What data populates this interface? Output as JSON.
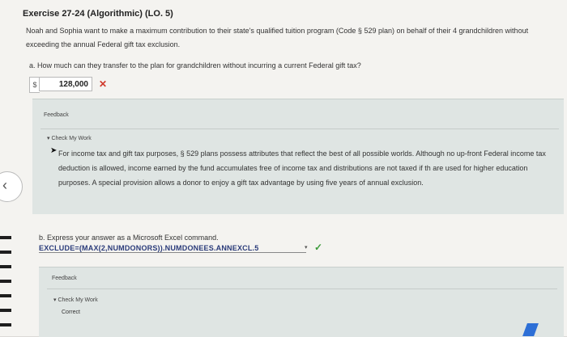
{
  "exercise": {
    "title": "Exercise 27-24 (Algorithmic) (LO. 5)",
    "problem": "Noah and Sophia want to make a maximum contribution to their state's qualified tuition program (Code § 529 plan) on behalf of their 4 grandchildren without exceeding the annual Federal gift tax exclusion."
  },
  "part_a": {
    "question": "a.  How much can they transfer to the plan for grandchildren without incurring a current Federal gift tax?",
    "currency": "$",
    "answer": "128,000",
    "status_mark": "✕",
    "feedback_label": "Feedback",
    "check_label": "▾ Check My Work",
    "explanation": "For income tax and gift tax purposes, § 529 plans possess attributes that reflect the best of all possible worlds. Although no up-front Federal income tax deduction is allowed, income earned by the fund accumulates free of income tax and distributions are not taxed if th are used for higher education purposes. A special provision allows a donor to enjoy a gift tax advantage by using five years of annual exclusion."
  },
  "part_b": {
    "question": "b.  Express your answer as a Microsoft Excel command.",
    "answer": "EXCLUDE=(MAX(2,NUMDONORS)).NUMDONEES.ANNEXCL.5",
    "status_mark": "✓",
    "feedback_label": "Feedback",
    "check_label": "▾ Check My Work",
    "result": "Correct"
  },
  "icons": {
    "nav_prev": "‹",
    "caret": "▾",
    "cursor": "➤"
  },
  "colors": {
    "incorrect": "#d0392b",
    "correct": "#3a9b3a",
    "feedback_bg": "#dfe5e3",
    "formula": "#2a3b7a"
  }
}
